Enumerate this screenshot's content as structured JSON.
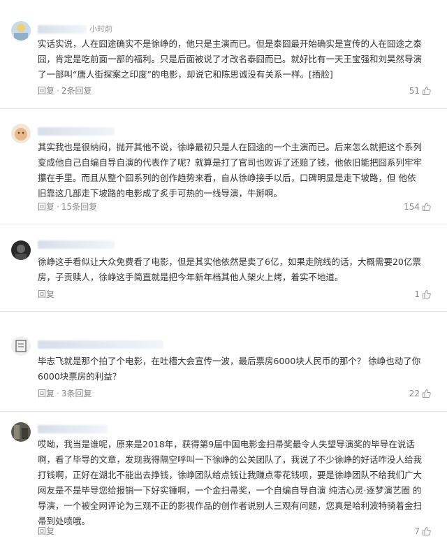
{
  "comments": [
    {
      "time": "小时前",
      "lines": [
        "实话实说，人在囧途确实不是徐峥的，他只是主演而已。但是泰囧最开始确实是宣传的人在囧途之泰",
        "囧，肯定是吃前面一部的福利。只是后面被说了才改名泰囧而已。就好比有一天王宝强和刘昊然导演",
        "了一部叫“唐人街探案之印度”的电影，却说它和陈思诚没有关系一样。[捂脸]"
      ],
      "reply_label": "回复",
      "reply_count": "2条回复",
      "likes": "51"
    },
    {
      "time": "",
      "lines": [
        "其实我也是很纳闷，抛开其他不说，徐峥最初只是人在囧途的一个主演而已。后来怎么就把这个系列",
        "变成他自己自编自导自演的代表作了呢？就算是打了官司也败诉了还赔了钱，他依旧能把囧系列牢牢",
        "攥在手里。而且从整个囧系列的创作趋势来看，自从徐峥接手以后，口碑明显是走下坡路，但 他依",
        "旧靠这几部走下坡路的电影成了炙手可热的一线导演，牛掰啊。"
      ],
      "reply_label": "回复",
      "reply_count": "15条回复",
      "likes": "154"
    },
    {
      "time": "",
      "lines": [
        "徐峥这手看似让大众免费看了电影，但是其实他依然是卖了6亿，如果走院线的话，大概需要20亿票",
        "房，子贡赎人，徐峥这手简直就是把今年新年档其他人架火上烤，着实不地道。"
      ],
      "reply_label": "回复",
      "reply_count": "",
      "likes": "1"
    },
    {
      "time": "",
      "lines": [
        "毕志飞就是那个拍了个电影，在吐槽大会宣传一波，最后票房6000块人民币的那个？ 徐峥也动了你",
        "6000块票房的利益？"
      ],
      "reply_label": "回复",
      "reply_count": "3条回复",
      "likes": "22"
    },
    {
      "time": "",
      "lines": [
        "哎呦，我当是谁呢，原来是2018年，获得第9届中国电影金扫帚奖最令人失望导演奖的毕导在说话",
        "啊，看了毕导的文章，发现我得隔空呼叫一下徐峥的公关团队了，我说了不少徐峥的好话咋没人给我",
        "打钱啊，正好在湖北不能出去挣钱，徐峥团队给点钱让我赚点零花钱呗，要是徐峥团队不给我们广大",
        "网友是不是毕导您给报销一下好实锤啊，一个金扫帚奖，一个自编自导自演 纯洁心灵·逐梦演艺圈 的",
        "导演，一个被全网评论为三观不正的影视作品的创作者说别人三观有问题，您真是哈利波特骑着金扫",
        "帚到处喷哦。"
      ],
      "reply_label": "回复",
      "reply_count": "",
      "likes": "7"
    }
  ]
}
